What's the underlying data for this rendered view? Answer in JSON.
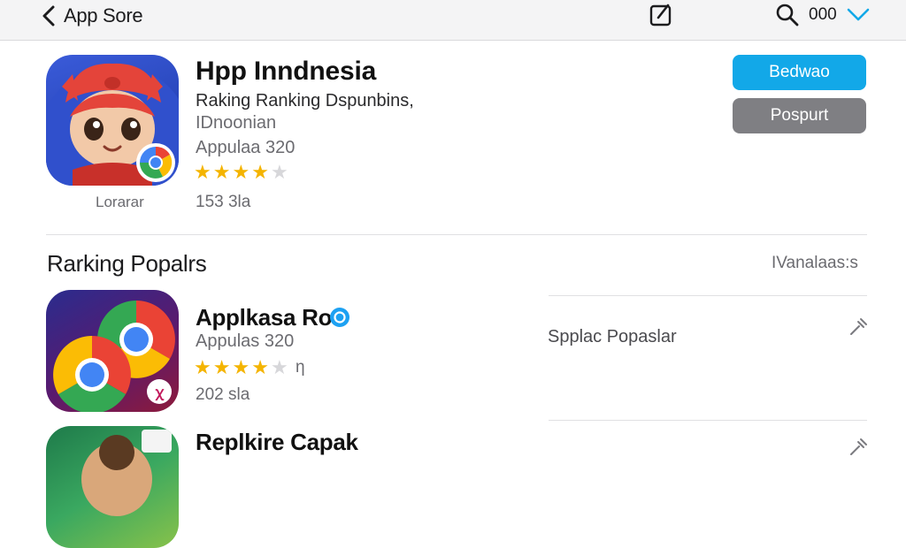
{
  "topbar": {
    "back_label": "App Sore",
    "back_icon": "chevron-left-icon",
    "compose_icon": "compose-icon",
    "search_icon": "search-icon",
    "search_count": "000",
    "dropdown_icon": "chevron-down-icon"
  },
  "hero": {
    "title": "Hpp Inndnesia",
    "subtitle_1": "Raking Ranking Dspunbins,",
    "subtitle_2": "IDnoonian",
    "meta": "Appulaa 320",
    "rating": 4,
    "rating_max": 5,
    "reviews": "153 3la",
    "caption": "Lorarar",
    "primary_button": "Bedwao",
    "secondary_button": "Pospurt"
  },
  "section": {
    "title": "Rarking Popalrs",
    "link": "IVanalaas:s"
  },
  "rows": [
    {
      "title": "Applkasa Ro",
      "verified": true,
      "meta": "Appulas 320",
      "rating": 4,
      "rating_max": 5,
      "rating_suffix": "η",
      "reviews": "202 sla",
      "side_label": "Spplac Popaslar"
    },
    {
      "title": "Replkire Capak"
    }
  ],
  "colors": {
    "accent": "#12a8e8",
    "secondary_button": "#7f7f83",
    "star": "#f4b400",
    "verified": "#1da1f2"
  }
}
